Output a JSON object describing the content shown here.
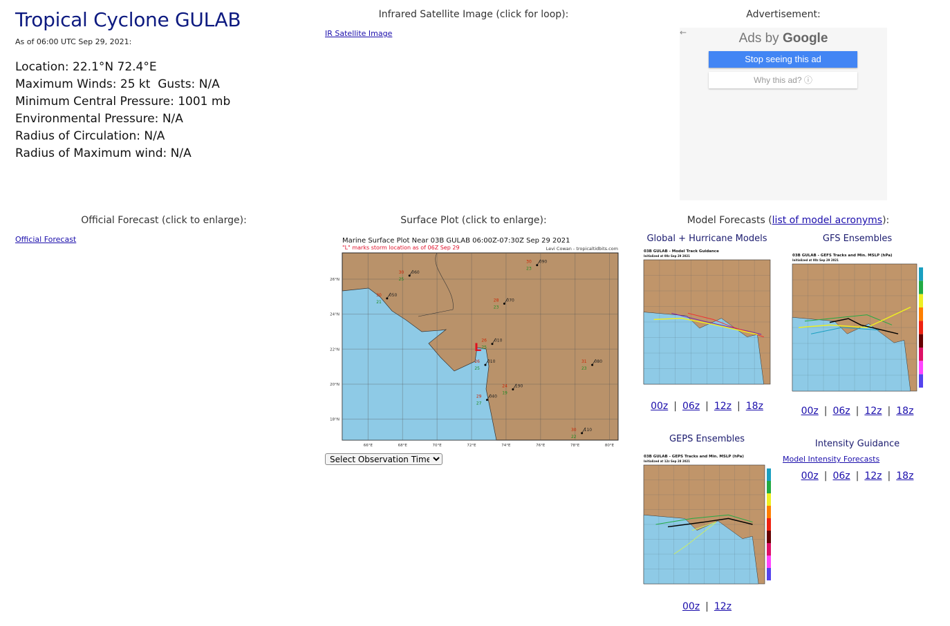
{
  "header": {
    "title": "Tropical Cyclone GULAB",
    "as_of": "As of 06:00 UTC Sep 29, 2021:"
  },
  "info": [
    "Location: 22.1°N 72.4°E",
    "Maximum Winds: 25 kt  Gusts: N/A",
    "Minimum Central Pressure: 1001 mb",
    "Environmental Pressure: N/A",
    "Radius of Circulation: N/A",
    "Radius of Maximum wind: N/A"
  ],
  "satellite": {
    "heading": "Infrared Satellite Image (click for loop):",
    "link": "IR Satellite Image"
  },
  "ad": {
    "heading": "Advertisement:",
    "ads_by": "Ads by",
    "google": "Google",
    "stop": "Stop seeing this ad",
    "why": "Why this ad? ⓘ",
    "back_icon": "arrow-left"
  },
  "official": {
    "heading": "Official Forecast (click to enlarge):",
    "link": "Official Forecast"
  },
  "surface": {
    "heading": "Surface Plot (click to enlarge):",
    "title": "Marine Surface Plot Near 03B GULAB 06:00Z-07:30Z Sep 29 2021",
    "subtitle": "\"L\" marks storm location as of 06Z Sep 29",
    "credit": "Levi Cowan - tropicaltidbits.com",
    "lat_ticks": [
      "18°N",
      "20°N",
      "22°N",
      "24°N",
      "26°N"
    ],
    "lon_ticks": [
      "66°E",
      "68°E",
      "70°E",
      "72°E",
      "74°E",
      "76°E",
      "78°E",
      "80°E"
    ],
    "colors": {
      "land": "#b9926a",
      "sea": "#8ecae6",
      "temp": "#cc2200",
      "dew": "#228b22"
    },
    "stations": [
      {
        "lon": 68.4,
        "lat": 26.2,
        "t": "30",
        "d": "25",
        "dir": "060"
      },
      {
        "lon": 67.1,
        "lat": 24.9,
        "t": "30",
        "d": "21",
        "dir": "050"
      },
      {
        "lon": 75.8,
        "lat": 26.8,
        "t": "30",
        "d": "23",
        "dir": "090"
      },
      {
        "lon": 73.9,
        "lat": 24.6,
        "t": "28",
        "d": "23",
        "dir": "070"
      },
      {
        "lon": 73.2,
        "lat": 22.3,
        "t": "26",
        "d": "25",
        "dir": "010"
      },
      {
        "lon": 72.8,
        "lat": 21.1,
        "t": "26",
        "d": "25",
        "dir": "010"
      },
      {
        "lon": 79.0,
        "lat": 21.1,
        "t": "31",
        "d": "23",
        "dir": "080"
      },
      {
        "lon": 74.4,
        "lat": 19.7,
        "t": "24",
        "d": "19",
        "dir": "190"
      },
      {
        "lon": 72.9,
        "lat": 19.1,
        "t": "29",
        "d": "27",
        "dir": "040"
      },
      {
        "lon": 78.4,
        "lat": 17.2,
        "t": "30",
        "d": "22",
        "dir": "110"
      }
    ],
    "storm": {
      "lon": 72.4,
      "lat": 22.1,
      "marker": "L"
    },
    "select": "Select Observation Time..."
  },
  "models": {
    "heading_prefix": "Model Forecasts (",
    "heading_link": "list of model acronyms",
    "heading_suffix": "):",
    "global": {
      "label": "Global + Hurricane Models",
      "img_title": "03B GULAB - Model Track Guidance",
      "img_sub": "Initialized at 00z Sep 29 2021",
      "runs": [
        "00z",
        "06z",
        "12z",
        "18z"
      ]
    },
    "gefs": {
      "label": "GFS Ensembles",
      "img_title": "03B GULAB - GEFS Tracks and Min. MSLP (hPa)",
      "img_sub": "Initialized at 00z Sep 29 2021",
      "runs": [
        "00z",
        "06z",
        "12z",
        "18z"
      ]
    },
    "geps": {
      "label": "GEPS Ensembles",
      "img_title": "03B GULAB - GEPS Tracks and Min. MSLP (hPa)",
      "img_sub": "Initialized at 12z Sep 28 2021",
      "runs": [
        "00z",
        "12z"
      ]
    },
    "intensity": {
      "label": "Intensity Guidance",
      "link": "Model Intensity Forecasts",
      "runs": [
        "00z",
        "06z",
        "12z",
        "18z"
      ]
    },
    "colorbar": [
      "#1a9fc0",
      "#22aa44",
      "#eeee22",
      "#ff7f00",
      "#ee2211",
      "#660000",
      "#dd1166",
      "#ff44ff",
      "#5544ee"
    ]
  }
}
